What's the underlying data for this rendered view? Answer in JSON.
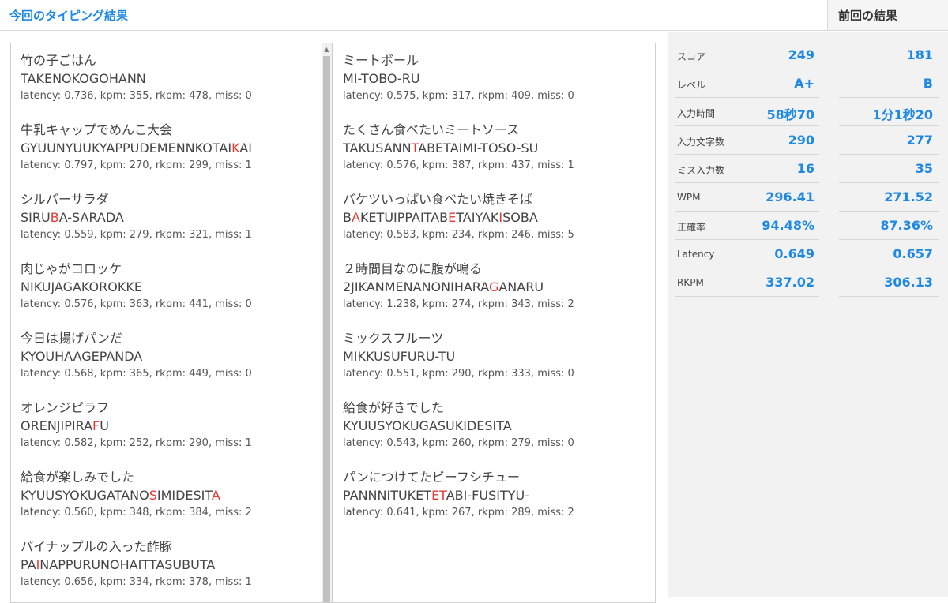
{
  "header": {
    "current_title": "今回のタイピング結果",
    "previous_title": "前回の結果"
  },
  "results_left": [
    {
      "jp": "竹の子ごはん",
      "romaji": "TAKENOKOGOHANN",
      "stat": "latency: 0.736, kpm: 355, rkpm: 478, miss: 0"
    },
    {
      "jp": "牛乳キャップでめんこ大会",
      "romaji": "GYUUNYUUKYAPPUDEMENNKOTAIKAI",
      "stat": "latency: 0.797, kpm: 270, rkpm: 299, miss: 1"
    },
    {
      "jp": "シルバーサラダ",
      "romaji": "SIRUBA-SARADA",
      "stat": "latency: 0.559, kpm: 279, rkpm: 321, miss: 1"
    },
    {
      "jp": "肉じゃがコロッケ",
      "romaji": "NIKUJAGAKOROKKE",
      "stat": "latency: 0.576, kpm: 363, rkpm: 441, miss: 0"
    },
    {
      "jp": "今日は揚げパンだ",
      "romaji": "KYOUHAAGEPANDA",
      "stat": "latency: 0.568, kpm: 365, rkpm: 449, miss: 0"
    },
    {
      "jp": "オレンジピラフ",
      "romaji": "ORENJIPIRAFU",
      "stat": "latency: 0.582, kpm: 252, rkpm: 290, miss: 1"
    },
    {
      "jp": "給食が楽しみでした",
      "romaji": "KYUUSYOKUGATANOSIMIDESITA",
      "stat": "latency: 0.560, kpm: 348, rkpm: 384, miss: 2"
    },
    {
      "jp": "パイナップルの入った酢豚",
      "romaji": "PAINAPPURUNOHAITTASUBUTA",
      "stat": "latency: 0.656, kpm: 334, rkpm: 378, miss: 1"
    }
  ],
  "results_right": [
    {
      "jp": "ミートボール",
      "romaji": "MI-TOBO-RU",
      "stat": "latency: 0.575, kpm: 317, rkpm: 409, miss: 0"
    },
    {
      "jp": "たくさん食べたいミートソース",
      "romaji": "TAKUSANNTABETAIMI-TOSO-SU",
      "stat": "latency: 0.576, kpm: 387, rkpm: 437, miss: 1"
    },
    {
      "jp": "バケツいっぱい食べたい焼きそば",
      "romaji": "BAKETUIPPAITABETAIYAKISOBA",
      "stat": "latency: 0.583, kpm: 234, rkpm: 246, miss: 5"
    },
    {
      "jp": "２時間目なのに腹が鳴る",
      "romaji": "2JIKANMENANONIHARAGANARU",
      "stat": "latency: 1.238, kpm: 274, rkpm: 343, miss: 2"
    },
    {
      "jp": "ミックスフルーツ",
      "romaji": "MIKKUSUFURU-TU",
      "stat": "latency: 0.551, kpm: 290, rkpm: 333, miss: 0"
    },
    {
      "jp": "給食が好きでした",
      "romaji": "KYUUSYOKUGASUKIDESITA",
      "stat": "latency: 0.543, kpm: 260, rkpm: 279, miss: 0"
    },
    {
      "jp": "パンにつけてたビーフシチュー",
      "romaji": "PANNNITUKETETABI-FUSITYU-",
      "stat": "latency: 0.641, kpm: 267, rkpm: 289, miss: 2"
    }
  ],
  "stats": [
    {
      "label": "スコア",
      "value": "249",
      "prev": "181"
    },
    {
      "label": "レベル",
      "value": "A+",
      "prev": "B"
    },
    {
      "label": "入力時間",
      "value": "58秒70",
      "prev": "1分1秒20"
    },
    {
      "label": "入力文字数",
      "value": "290",
      "prev": "277"
    },
    {
      "label": "ミス入力数",
      "value": "16",
      "prev": "35"
    },
    {
      "label": "WPM",
      "value": "296.41",
      "prev": "271.52"
    },
    {
      "label": "正確率",
      "value": "94.48%",
      "prev": "87.36%"
    },
    {
      "label": "Latency",
      "value": "0.649",
      "prev": "0.657"
    },
    {
      "label": "RKPM",
      "value": "337.02",
      "prev": "306.13"
    }
  ],
  "colors": {
    "accent": "#1e88e5",
    "miss": "#e53935"
  }
}
